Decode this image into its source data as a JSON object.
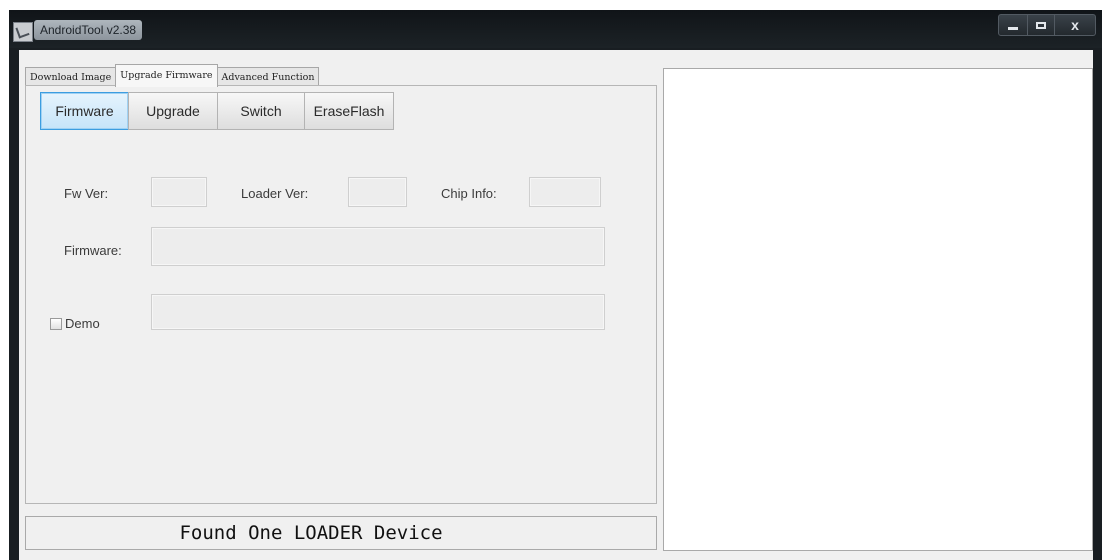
{
  "window": {
    "title": "AndroidTool v2.38",
    "controls": {
      "minimize": "minimize",
      "maximize": "maximize",
      "close": "x"
    }
  },
  "tabs": [
    {
      "label": "Download Image",
      "active": false
    },
    {
      "label": "Upgrade Firmware",
      "active": true
    },
    {
      "label": "Advanced Function",
      "active": false
    }
  ],
  "toolbar": {
    "firmware": "Firmware",
    "upgrade": "Upgrade",
    "switch": "Switch",
    "erase_flash": "EraseFlash"
  },
  "info": {
    "fw_ver_label": "Fw Ver:",
    "fw_ver_value": "",
    "loader_ver_label": "Loader Ver:",
    "loader_ver_value": "",
    "chip_info_label": "Chip Info:",
    "chip_info_value": "",
    "firmware_label": "Firmware:",
    "firmware_value": "",
    "demo_label": "Demo",
    "demo_checked": false,
    "demo_value": ""
  },
  "status": {
    "text": "Found One LOADER Device"
  },
  "log": {
    "text": ""
  },
  "colors": {
    "active_button_border": "#3c9de0",
    "titlebar": "#191e22"
  }
}
